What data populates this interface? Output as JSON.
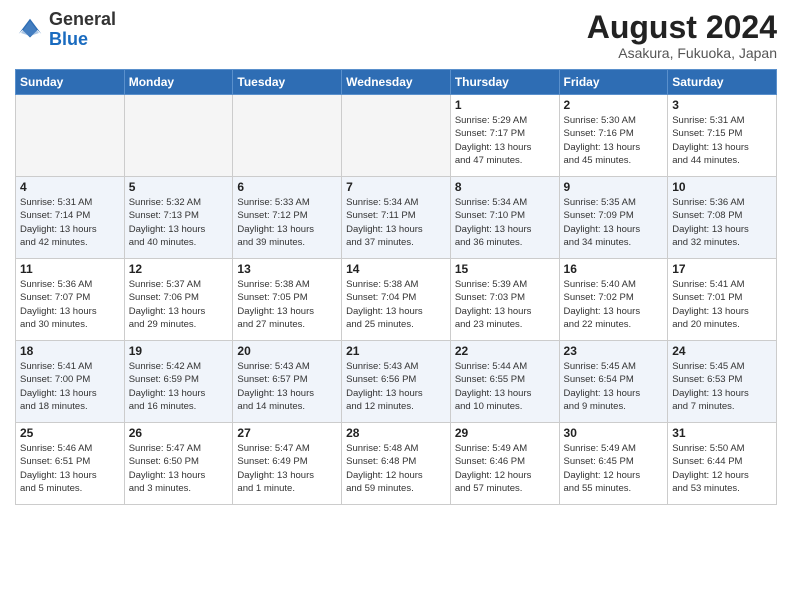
{
  "header": {
    "logo_line1": "General",
    "logo_line2": "Blue",
    "month_year": "August 2024",
    "location": "Asakura, Fukuoka, Japan"
  },
  "weekdays": [
    "Sunday",
    "Monday",
    "Tuesday",
    "Wednesday",
    "Thursday",
    "Friday",
    "Saturday"
  ],
  "weeks": [
    {
      "row_class": "row-odd",
      "days": [
        {
          "number": "",
          "info": "",
          "empty": true
        },
        {
          "number": "",
          "info": "",
          "empty": true
        },
        {
          "number": "",
          "info": "",
          "empty": true
        },
        {
          "number": "",
          "info": "",
          "empty": true
        },
        {
          "number": "1",
          "info": "Sunrise: 5:29 AM\nSunset: 7:17 PM\nDaylight: 13 hours\nand 47 minutes."
        },
        {
          "number": "2",
          "info": "Sunrise: 5:30 AM\nSunset: 7:16 PM\nDaylight: 13 hours\nand 45 minutes."
        },
        {
          "number": "3",
          "info": "Sunrise: 5:31 AM\nSunset: 7:15 PM\nDaylight: 13 hours\nand 44 minutes."
        }
      ]
    },
    {
      "row_class": "row-even",
      "days": [
        {
          "number": "4",
          "info": "Sunrise: 5:31 AM\nSunset: 7:14 PM\nDaylight: 13 hours\nand 42 minutes."
        },
        {
          "number": "5",
          "info": "Sunrise: 5:32 AM\nSunset: 7:13 PM\nDaylight: 13 hours\nand 40 minutes."
        },
        {
          "number": "6",
          "info": "Sunrise: 5:33 AM\nSunset: 7:12 PM\nDaylight: 13 hours\nand 39 minutes."
        },
        {
          "number": "7",
          "info": "Sunrise: 5:34 AM\nSunset: 7:11 PM\nDaylight: 13 hours\nand 37 minutes."
        },
        {
          "number": "8",
          "info": "Sunrise: 5:34 AM\nSunset: 7:10 PM\nDaylight: 13 hours\nand 36 minutes."
        },
        {
          "number": "9",
          "info": "Sunrise: 5:35 AM\nSunset: 7:09 PM\nDaylight: 13 hours\nand 34 minutes."
        },
        {
          "number": "10",
          "info": "Sunrise: 5:36 AM\nSunset: 7:08 PM\nDaylight: 13 hours\nand 32 minutes."
        }
      ]
    },
    {
      "row_class": "row-odd",
      "days": [
        {
          "number": "11",
          "info": "Sunrise: 5:36 AM\nSunset: 7:07 PM\nDaylight: 13 hours\nand 30 minutes."
        },
        {
          "number": "12",
          "info": "Sunrise: 5:37 AM\nSunset: 7:06 PM\nDaylight: 13 hours\nand 29 minutes."
        },
        {
          "number": "13",
          "info": "Sunrise: 5:38 AM\nSunset: 7:05 PM\nDaylight: 13 hours\nand 27 minutes."
        },
        {
          "number": "14",
          "info": "Sunrise: 5:38 AM\nSunset: 7:04 PM\nDaylight: 13 hours\nand 25 minutes."
        },
        {
          "number": "15",
          "info": "Sunrise: 5:39 AM\nSunset: 7:03 PM\nDaylight: 13 hours\nand 23 minutes."
        },
        {
          "number": "16",
          "info": "Sunrise: 5:40 AM\nSunset: 7:02 PM\nDaylight: 13 hours\nand 22 minutes."
        },
        {
          "number": "17",
          "info": "Sunrise: 5:41 AM\nSunset: 7:01 PM\nDaylight: 13 hours\nand 20 minutes."
        }
      ]
    },
    {
      "row_class": "row-even",
      "days": [
        {
          "number": "18",
          "info": "Sunrise: 5:41 AM\nSunset: 7:00 PM\nDaylight: 13 hours\nand 18 minutes."
        },
        {
          "number": "19",
          "info": "Sunrise: 5:42 AM\nSunset: 6:59 PM\nDaylight: 13 hours\nand 16 minutes."
        },
        {
          "number": "20",
          "info": "Sunrise: 5:43 AM\nSunset: 6:57 PM\nDaylight: 13 hours\nand 14 minutes."
        },
        {
          "number": "21",
          "info": "Sunrise: 5:43 AM\nSunset: 6:56 PM\nDaylight: 13 hours\nand 12 minutes."
        },
        {
          "number": "22",
          "info": "Sunrise: 5:44 AM\nSunset: 6:55 PM\nDaylight: 13 hours\nand 10 minutes."
        },
        {
          "number": "23",
          "info": "Sunrise: 5:45 AM\nSunset: 6:54 PM\nDaylight: 13 hours\nand 9 minutes."
        },
        {
          "number": "24",
          "info": "Sunrise: 5:45 AM\nSunset: 6:53 PM\nDaylight: 13 hours\nand 7 minutes."
        }
      ]
    },
    {
      "row_class": "row-odd",
      "days": [
        {
          "number": "25",
          "info": "Sunrise: 5:46 AM\nSunset: 6:51 PM\nDaylight: 13 hours\nand 5 minutes."
        },
        {
          "number": "26",
          "info": "Sunrise: 5:47 AM\nSunset: 6:50 PM\nDaylight: 13 hours\nand 3 minutes."
        },
        {
          "number": "27",
          "info": "Sunrise: 5:47 AM\nSunset: 6:49 PM\nDaylight: 13 hours\nand 1 minute."
        },
        {
          "number": "28",
          "info": "Sunrise: 5:48 AM\nSunset: 6:48 PM\nDaylight: 12 hours\nand 59 minutes."
        },
        {
          "number": "29",
          "info": "Sunrise: 5:49 AM\nSunset: 6:46 PM\nDaylight: 12 hours\nand 57 minutes."
        },
        {
          "number": "30",
          "info": "Sunrise: 5:49 AM\nSunset: 6:45 PM\nDaylight: 12 hours\nand 55 minutes."
        },
        {
          "number": "31",
          "info": "Sunrise: 5:50 AM\nSunset: 6:44 PM\nDaylight: 12 hours\nand 53 minutes."
        }
      ]
    }
  ]
}
